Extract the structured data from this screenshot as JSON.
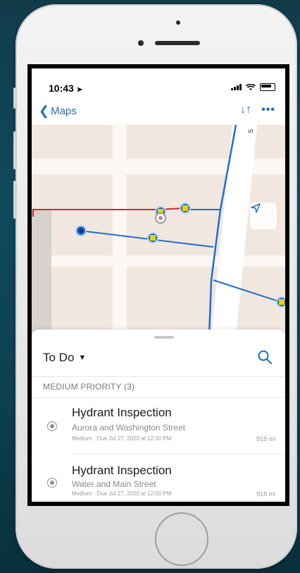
{
  "status_bar": {
    "time": "10:43"
  },
  "nav_bar": {
    "back_label": "Maps",
    "sort_icon": "sort-arrows-icon",
    "more_label": "•••"
  },
  "map": {
    "colors": {
      "water_main": "#1e6fd0",
      "red_line": "#d9262f",
      "feature": "#1a66c7",
      "hydrant": "#e6d400"
    }
  },
  "sheet": {
    "title": "To Do",
    "search_icon": "search-icon",
    "section_header": "MEDIUM PRIORITY (3)",
    "items": [
      {
        "title": "Hydrant Inspection",
        "subtitle": "Aurora and Washington Street",
        "meta": "Medium · Due Jul 27, 2020 at 12:30 PM",
        "distance": "918 mi"
      },
      {
        "title": "Hydrant Inspection",
        "subtitle": "Water and Main Street",
        "meta": "Medium · Due Jul 27, 2020 at 12:00 PM",
        "distance": "918 mi"
      }
    ]
  }
}
